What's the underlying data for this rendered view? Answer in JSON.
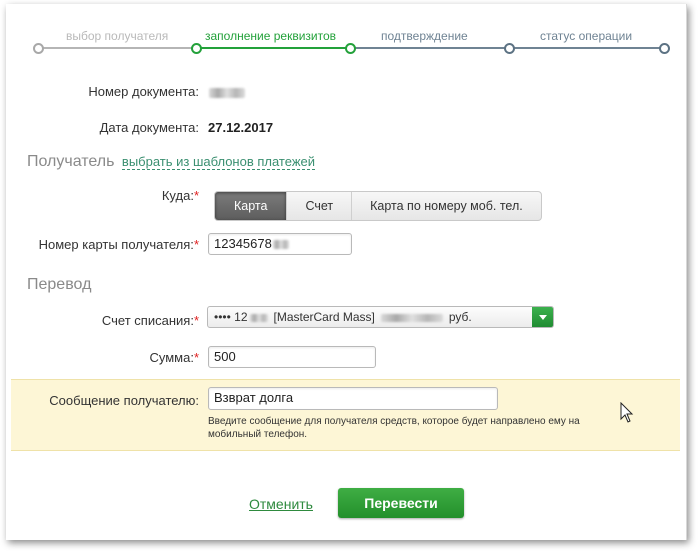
{
  "steps": [
    {
      "label": "выбор получателя",
      "state": "done"
    },
    {
      "label": "заполнение реквизитов",
      "state": "current"
    },
    {
      "label": "подтверждение",
      "state": "pending"
    },
    {
      "label": "статус операции",
      "state": "pending"
    }
  ],
  "document": {
    "number_label": "Номер документа:",
    "date_label": "Дата документа:",
    "date_value": "27.12.2017"
  },
  "recipient": {
    "section_title": "Получатель",
    "templates_link": "выбрать из шаблонов платежей",
    "where_label": "Куда:",
    "where_options": [
      "Карта",
      "Счет",
      "Карта по номеру моб. тел."
    ],
    "where_selected": "Карта",
    "card_label": "Номер карты получателя:",
    "card_value": "12345678"
  },
  "transfer": {
    "section_title": "Перевод",
    "account_label": "Счет списания:",
    "account_prefix": "•••• 12",
    "account_name": "[MasterCard Mass]",
    "account_currency": "руб.",
    "amount_label": "Сумма:",
    "amount_value": "500",
    "message_label": "Сообщение получателю:",
    "message_value": "Взврат долга",
    "message_hint": "Введите сообщение для получателя средств, которое будет направлено ему на мобильный телефон."
  },
  "actions": {
    "cancel_label": "Отменить",
    "submit_label": "Перевести"
  },
  "colors": {
    "accent_green": "#23a13a",
    "hint_background": "#fdf6d6"
  }
}
